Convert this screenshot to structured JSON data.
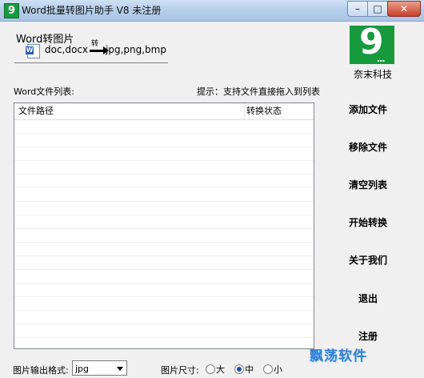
{
  "window": {
    "title": "Word批量转图片助手 V8 未注册",
    "icon_text": "9",
    "controls": {
      "minimize": "–",
      "maximize": "□",
      "close": "✕"
    }
  },
  "header": {
    "title": "Word转图片",
    "from": "doc,docx",
    "arrow_label": "转",
    "to": "jpg,png,bmp"
  },
  "logo": {
    "digit": "9",
    "dots": "...",
    "caption": "奈末科技"
  },
  "list": {
    "label": "Word文件列表:",
    "hint": "提示：支持文件直接拖入到列表",
    "columns": [
      "文件路径",
      "转换状态"
    ],
    "rows": []
  },
  "sidebar": {
    "buttons": [
      "添加文件",
      "移除文件",
      "清空列表",
      "开始转换",
      "关于我们",
      "退出",
      "注册"
    ]
  },
  "footer": {
    "format_label": "图片输出格式:",
    "format_value": "jpg",
    "size_label": "图片尺寸:",
    "size_options": [
      "大",
      "中",
      "小"
    ],
    "size_selected": "中"
  },
  "watermark": "飘荡软件",
  "colors": {
    "brand_green": "#179a3e",
    "watermark_blue": "#2f7fd6"
  }
}
